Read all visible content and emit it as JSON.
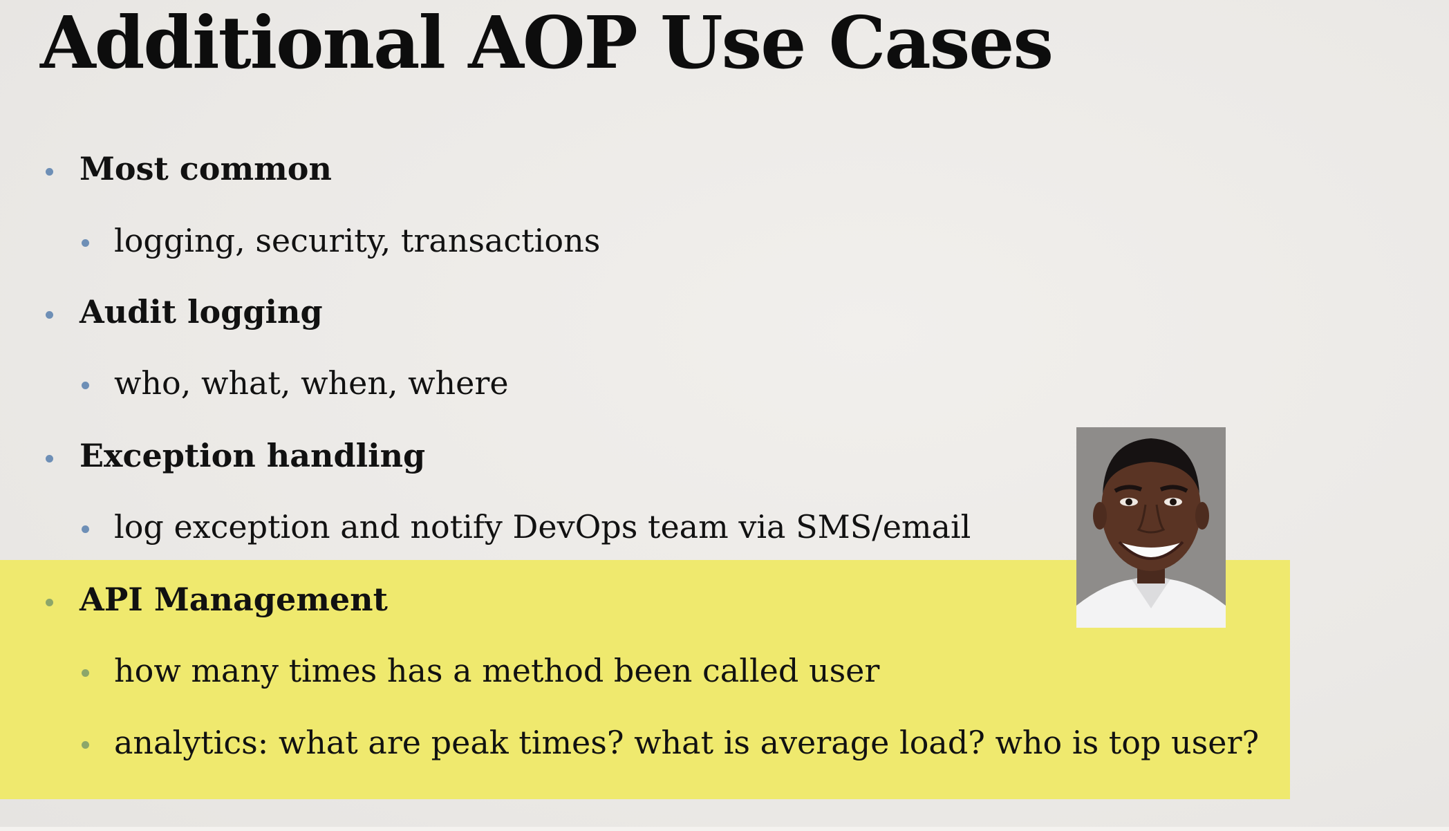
{
  "slide": {
    "title": "Additional AOP Use Cases",
    "sections": [
      {
        "heading": "Most common",
        "points": [
          "logging, security, transactions"
        ]
      },
      {
        "heading": "Audit logging",
        "points": [
          "who, what, when, where"
        ]
      },
      {
        "heading": "Exception handling",
        "points": [
          "log exception and notify DevOps team via SMS/email"
        ]
      },
      {
        "heading": "API Management",
        "points": [
          "how many times has a method been called user",
          "analytics: what are peak times? what is average load?  who is top user?"
        ]
      }
    ]
  },
  "colors": {
    "highlight": "#efe96e",
    "bullet": "#6e8fb6",
    "bullet_on_highlight": "#8ca66a",
    "text": "#111111"
  },
  "icons": {
    "bullet": "dot-bullet-icon"
  }
}
